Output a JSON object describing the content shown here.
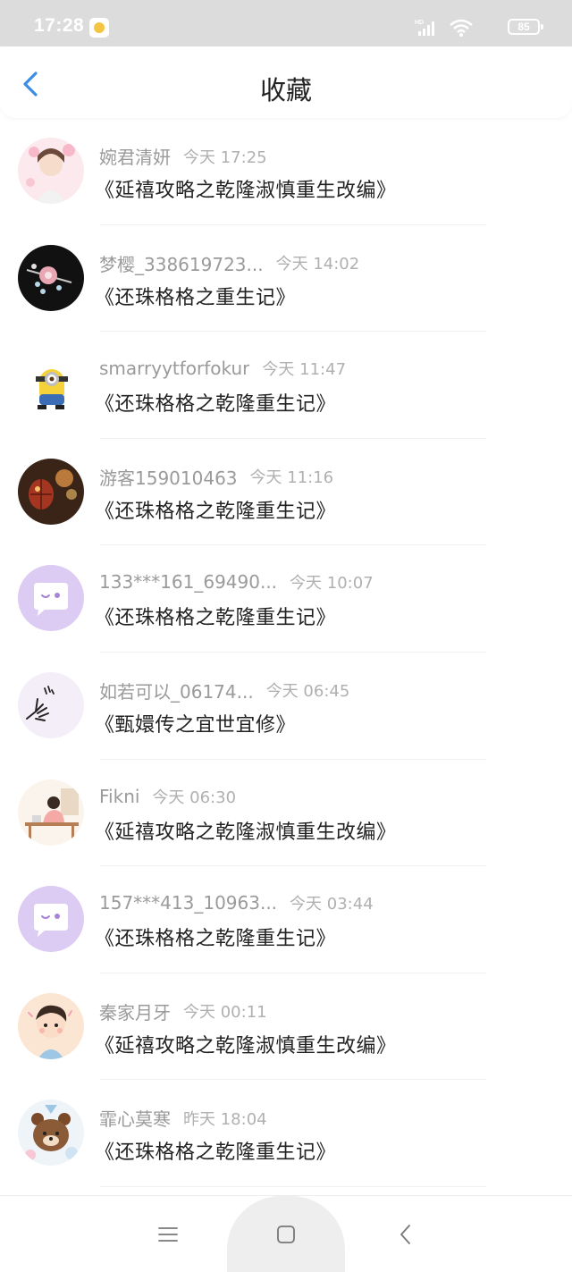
{
  "status_bar": {
    "time": "17:28",
    "battery": "85",
    "network": "HD"
  },
  "header": {
    "title": "收藏"
  },
  "favorites": [
    {
      "username": "婉君清妍",
      "time": "今天 17:25",
      "book": "《延禧攻略之乾隆淑慎重生改编》",
      "avatar": "girl-illustration-avatar"
    },
    {
      "username": "梦樱_338619723...",
      "time": "今天 14:02",
      "book": "《还珠格格之重生记》",
      "avatar": "hairpin-avatar"
    },
    {
      "username": "smarryytforfokur",
      "time": "今天 11:47",
      "book": "《还珠格格之乾隆重生记》",
      "avatar": "minion-avatar"
    },
    {
      "username": "游客159010463",
      "time": "今天 11:16",
      "book": "《还珠格格之乾隆重生记》",
      "avatar": "lantern-avatar"
    },
    {
      "username": "133***161_69490...",
      "time": "今天 10:07",
      "book": "《还珠格格之乾隆重生记》",
      "avatar": "default-chat-avatar"
    },
    {
      "username": "如若可以_06174...",
      "time": "今天 06:45",
      "book": "《甄嬛传之宜世宜修》",
      "avatar": "hand-sketch-avatar"
    },
    {
      "username": "Fikni",
      "time": "今天 06:30",
      "book": "《延禧攻略之乾隆淑慎重生改编》",
      "avatar": "desk-girl-avatar"
    },
    {
      "username": "157***413_10963...",
      "time": "今天 03:44",
      "book": "《还珠格格之乾隆重生记》",
      "avatar": "default-chat-avatar"
    },
    {
      "username": "秦家月牙",
      "time": "今天 00:11",
      "book": "《延禧攻略之乾隆淑慎重生改编》",
      "avatar": "boy-cartoon-avatar"
    },
    {
      "username": "霏心莫寒",
      "time": "昨天 18:04",
      "book": "《还珠格格之乾隆重生记》",
      "avatar": "brown-bear-avatar"
    }
  ],
  "nav_bar": {
    "icons": [
      "menu-icon",
      "home-icon",
      "back-icon"
    ]
  },
  "colors": {
    "accent": "#3a8ee6",
    "default_avatar_bg": "#dccbf2"
  }
}
